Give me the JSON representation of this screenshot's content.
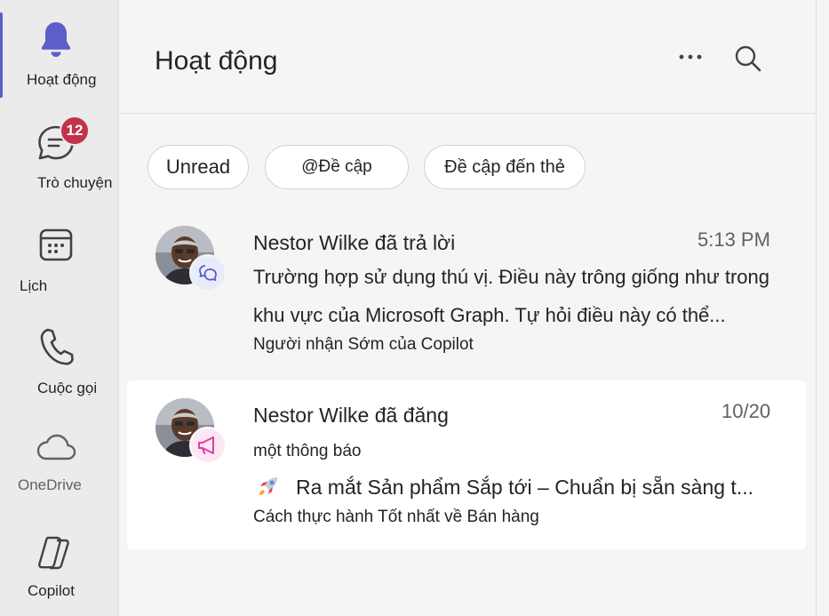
{
  "rail": {
    "items": [
      {
        "label": "Hoạt động",
        "icon": "bell-icon",
        "active": true
      },
      {
        "label": "Trò chuyện",
        "icon": "chat-icon",
        "badge": "12"
      },
      {
        "label": "Lịch",
        "icon": "calendar-icon"
      },
      {
        "label": "Cuộc gọi",
        "icon": "phone-icon"
      },
      {
        "label": "OneDrive",
        "icon": "cloud-icon"
      },
      {
        "label": "Copilot",
        "icon": "copilot-icon"
      }
    ]
  },
  "header": {
    "title": "Hoạt động",
    "more_icon": "more-icon",
    "search_icon": "search-icon"
  },
  "filters": [
    "Unread",
    "@Đề cập",
    "Đề cập đến thẻ"
  ],
  "activities": [
    {
      "title": "Nestor Wilke đã trả lời",
      "time": "5:13 PM",
      "line1": "Trường hợp sử dụng thú vị. Điều này trông giống như trong",
      "line2": "khu vực của Microsoft Graph. Tự hỏi điều này có thể...",
      "source": "Người nhận Sớm của Copilot",
      "badge_icon": "reply-icon"
    },
    {
      "title": "Nestor Wilke đã đăng",
      "time": "10/20",
      "subtitle": "một thông báo",
      "line1": "Ra mắt Sản phẩm Sắp tới – Chuẩn bị sẵn sàng t...",
      "source": "Cách thực hành Tốt nhất về Bán hàng",
      "badge_icon": "megaphone-icon",
      "emoji_icon": "rocket-icon"
    }
  ],
  "colors": {
    "accent": "#5b5fc7",
    "badge": "#c4314b",
    "announce": "#e43ba6"
  }
}
